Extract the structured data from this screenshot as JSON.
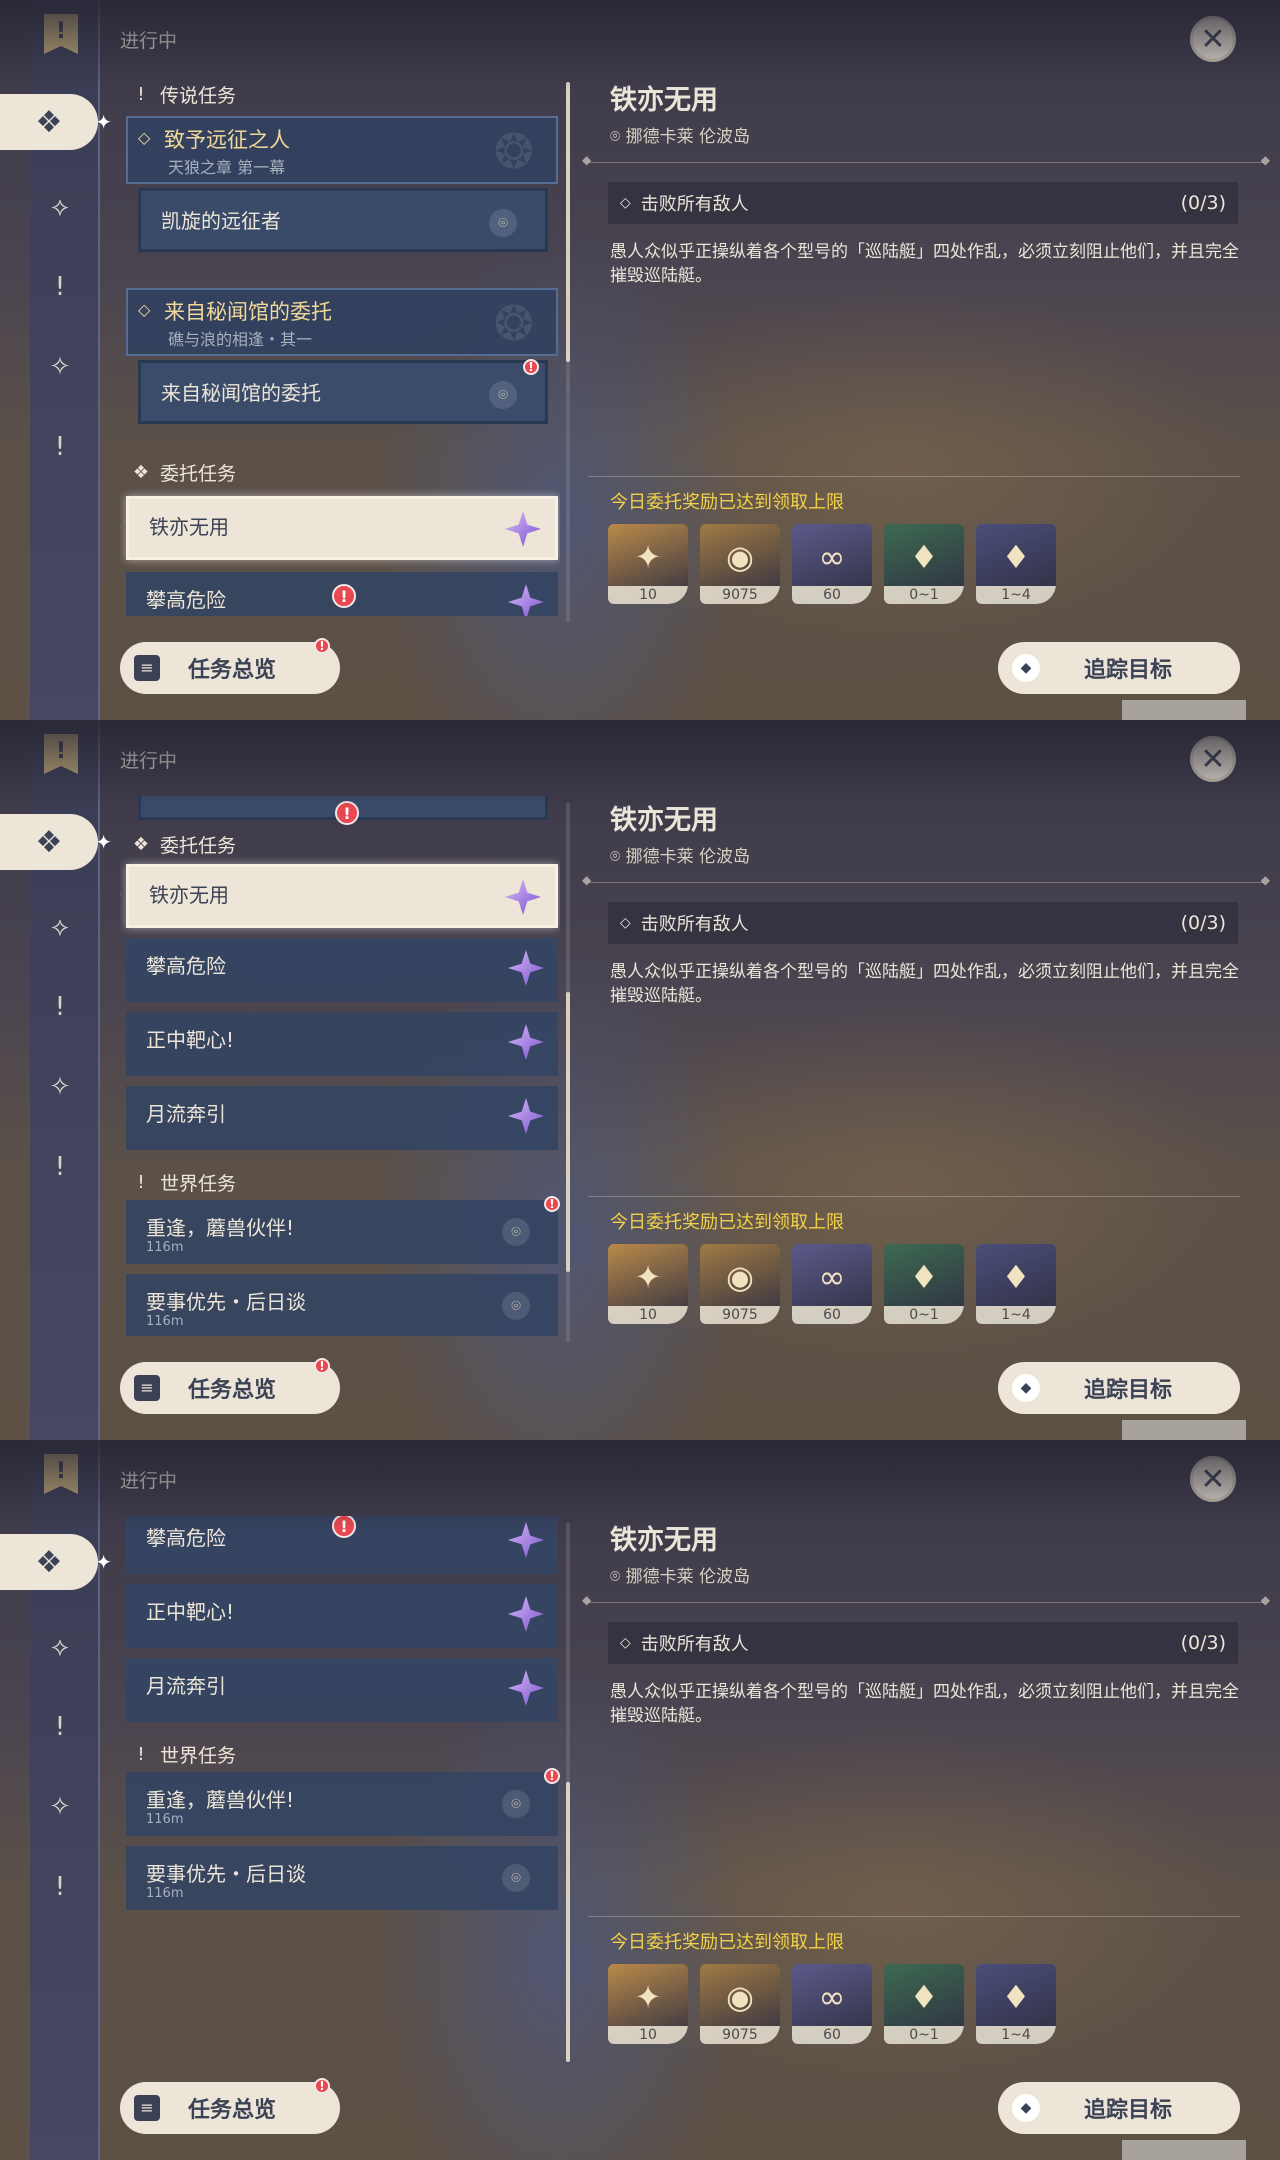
{
  "panels": [
    {
      "header": {
        "progress_label": "进行中"
      },
      "rail": {
        "items": [
          "banner-icon",
          "commission-icon",
          "archon-quest-icon",
          "world-quest-icon",
          "story-quest-icon",
          "exclaim-icon"
        ],
        "active_index": 1
      },
      "sections": {
        "legend": {
          "label": "传说任务"
        },
        "chapter1": {
          "title": "致予远征之人",
          "subtitle": "天狼之章 第一幕"
        },
        "chapter1_quest": {
          "title": "凯旋的远征者"
        },
        "chapter2": {
          "title": "来自秘闻馆的委托",
          "subtitle": "礁与浪的相逢・其一"
        },
        "chapter2_quest": {
          "title": "来自秘闻馆的委托"
        },
        "commission": {
          "label": "委托任务"
        },
        "q1": {
          "title": "铁亦无用"
        },
        "q2": {
          "title": "攀高危险"
        }
      },
      "buttons": {
        "overview": "任务总览",
        "track": "追踪目标"
      }
    },
    {
      "header": {
        "progress_label": "进行中"
      },
      "sections": {
        "commission": {
          "label": "委托任务"
        },
        "q1": {
          "title": "铁亦无用"
        },
        "q2": {
          "title": "攀高危险"
        },
        "q3": {
          "title": "正中靶心!"
        },
        "q4": {
          "title": "月流奔引"
        },
        "world": {
          "label": "世界任务"
        },
        "w1": {
          "title": "重逢，蘑兽伙伴!",
          "distance": "116m"
        },
        "w2": {
          "title": "要事优先・后日谈",
          "distance": "116m"
        }
      },
      "buttons": {
        "overview": "任务总览",
        "track": "追踪目标"
      }
    },
    {
      "header": {
        "progress_label": "进行中"
      },
      "sections": {
        "q2": {
          "title": "攀高危险"
        },
        "q3": {
          "title": "正中靶心!"
        },
        "q4": {
          "title": "月流奔引"
        },
        "world": {
          "label": "世界任务"
        },
        "w1": {
          "title": "重逢，蘑兽伙伴!",
          "distance": "116m"
        },
        "w2": {
          "title": "要事优先・后日谈",
          "distance": "116m"
        }
      },
      "buttons": {
        "overview": "任务总览",
        "track": "追踪目标"
      }
    }
  ],
  "detail": {
    "title": "铁亦无用",
    "location": "挪德卡莱 伦波岛",
    "objective": {
      "text": "击败所有敌人",
      "progress": "(0/3)"
    },
    "description": "愚人众似乎正操纵着各个型号的「巡陆艇」四处作乱，必须立刻阻止他们，并且完全摧毁巡陆艇。",
    "reward_note": "今日委托奖励已达到领取上限",
    "rewards": [
      {
        "name": "adventure-exp-icon",
        "count": "10",
        "color": "#b98a4a",
        "glyph": "✦"
      },
      {
        "name": "mora-icon",
        "count": "9075",
        "color": "#a07a45",
        "glyph": "◉"
      },
      {
        "name": "companionship-exp-icon",
        "count": "60",
        "color": "#5c5a8a",
        "glyph": "∞"
      },
      {
        "name": "crystal-small-icon",
        "count": "0~1",
        "color": "#3d6a52",
        "glyph": "♦"
      },
      {
        "name": "crystal-cluster-icon",
        "count": "1~4",
        "color": "#4b4e7a",
        "glyph": "♦"
      }
    ]
  },
  "colors": {
    "accent_yellow": "#f3d248",
    "paper": "#ece5d8",
    "alert": "#e8484f",
    "gem_purple": "#7b54c9"
  }
}
